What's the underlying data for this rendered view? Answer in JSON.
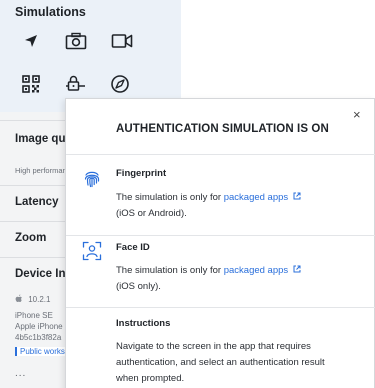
{
  "sidebar": {
    "simulations_title": "Simulations",
    "simulation_icons": [
      "location-arrow-icon",
      "camera-icon",
      "video-camera-icon",
      "qr-code-icon",
      "network-lock-icon",
      "compass-icon"
    ],
    "image_quality_label": "Image qua",
    "performance_text": "High performan",
    "latency_label": "Latency",
    "zoom_label": "Zoom",
    "device_info_label": "Device Info",
    "device": {
      "os_version": "10.2.1",
      "model": "iPhone SE",
      "maker_line": "Apple iPhone",
      "id": "4b5c1b3f82a",
      "badge": "Public works",
      "more": "..."
    }
  },
  "panel": {
    "title": "AUTHENTICATION SIMULATION IS ON",
    "close_label": "×",
    "fingerprint": {
      "heading": "Fingerprint",
      "text_prefix": "The simulation is only for ",
      "link": "packaged apps",
      "text_suffix": "(iOS or Android)."
    },
    "face_id": {
      "heading": "Face ID",
      "text_prefix": "The simulation is only for ",
      "link": "packaged apps",
      "text_suffix": "(iOS only)."
    },
    "instructions": {
      "heading": "Instructions",
      "line1": "Navigate to the screen in the app that requires",
      "line2": "authentication, and select an authentication result",
      "line3": "when prompted."
    }
  },
  "colors": {
    "accent": "#2a6fdb",
    "sidebar_bg": "#f3f4f5",
    "highlight_bg": "#ebf1f8"
  }
}
